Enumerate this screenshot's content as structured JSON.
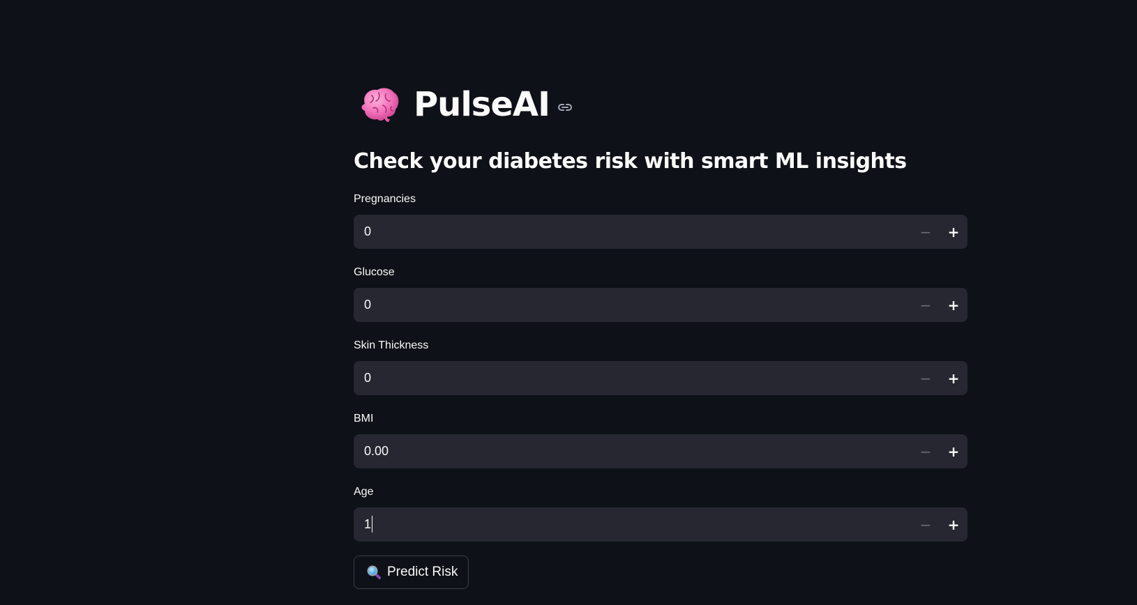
{
  "header": {
    "title": "PulseAI",
    "brain_icon": "brain-icon",
    "anchor_icon": "link-icon"
  },
  "subtitle": "Check your diabetes risk with smart ML insights",
  "fields": [
    {
      "label": "Pregnancies",
      "value": "0"
    },
    {
      "label": "Glucose",
      "value": "0"
    },
    {
      "label": "Skin Thickness",
      "value": "0"
    },
    {
      "label": "BMI",
      "value": "0.00"
    },
    {
      "label": "Age",
      "value": "1"
    }
  ],
  "stepper": {
    "minus": "−",
    "plus": "+"
  },
  "predict_button": {
    "label": "Predict Risk",
    "icon": "magnifying-glass-icon"
  },
  "colors": {
    "background": "#0e1117",
    "input_background": "#262730",
    "text": "#fafafa",
    "brain": "#f472b6"
  }
}
